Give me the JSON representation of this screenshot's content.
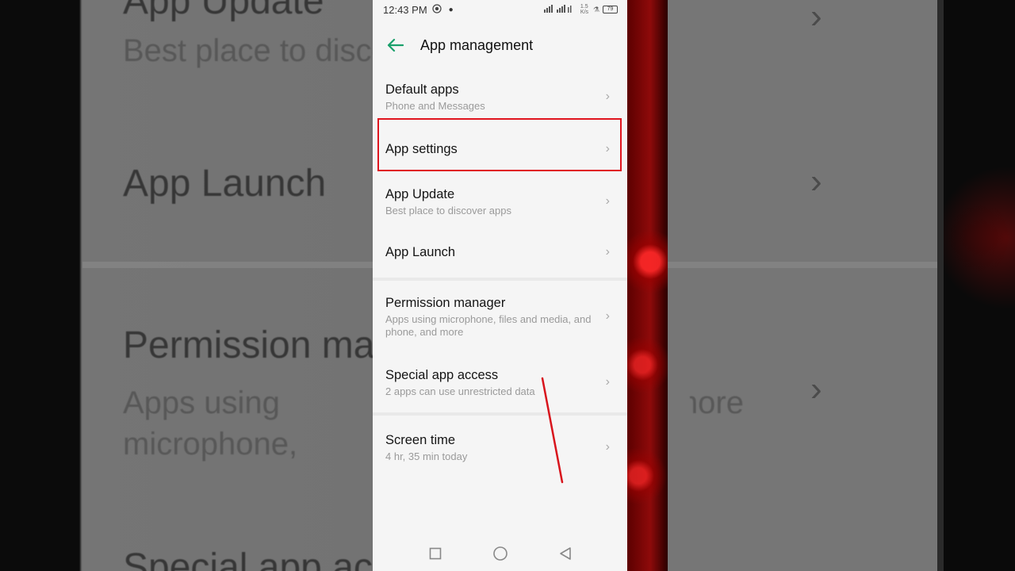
{
  "status_bar": {
    "time": "12:43 PM",
    "speed": "1.5 K/s",
    "battery": "79"
  },
  "header": {
    "back_icon": "arrow-left-icon",
    "title": "App management"
  },
  "items": [
    {
      "label": "Default apps",
      "sub": "Phone and Messages"
    },
    {
      "label": "App settings",
      "sub": ""
    },
    {
      "label": "App Update",
      "sub": "Best place to discover apps"
    },
    {
      "label": "App Launch",
      "sub": ""
    },
    {
      "label": "Permission manager",
      "sub": "Apps using microphone, files and media, and phone, and more"
    },
    {
      "label": "Special app access",
      "sub": "2 apps can use unrestricted data"
    },
    {
      "label": "Screen time",
      "sub": "4 hr, 35 min today"
    }
  ],
  "navbar": {
    "recents_icon": "square-icon",
    "home_icon": "circle-icon",
    "back_icon": "triangle-back-icon"
  },
  "colors": {
    "accent": "#1aa06b",
    "highlight": "#e0141e"
  }
}
